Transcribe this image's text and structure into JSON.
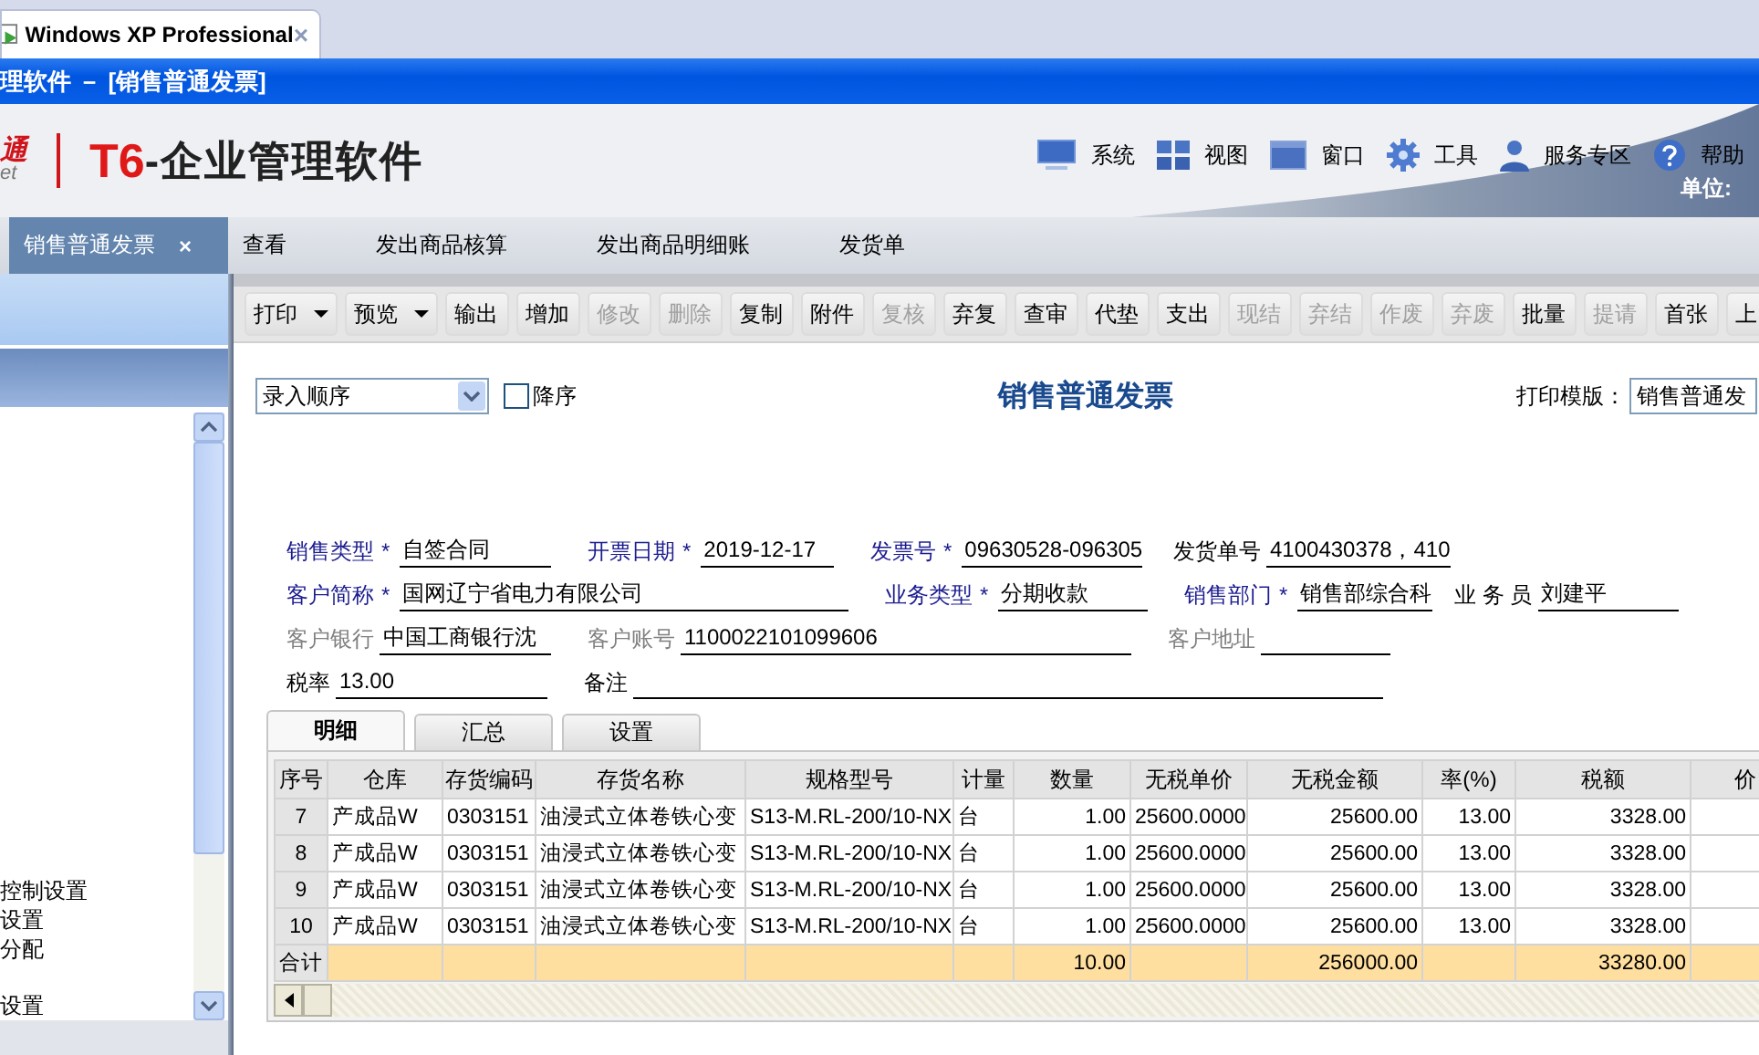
{
  "browser_tab": {
    "title": "Windows XP Professional",
    "close": "×"
  },
  "window": {
    "title": "理软件 － [销售普通发票]"
  },
  "header": {
    "logo_mark": "通",
    "logo_sub": "et",
    "brand_code": "T6",
    "brand_name": "-企业管理软件",
    "menu": [
      {
        "label": "系统",
        "kind": "monitor"
      },
      {
        "label": "视图",
        "kind": "grid"
      },
      {
        "label": "窗口",
        "kind": "window"
      },
      {
        "label": "工具",
        "kind": "gear"
      },
      {
        "label": "服务专区",
        "kind": "person"
      },
      {
        "label": "帮助",
        "kind": "help"
      }
    ],
    "unit": "单位:"
  },
  "doc_tabs": [
    {
      "label": "销售普通发票",
      "selected": true,
      "close": "×"
    },
    {
      "label": "查看",
      "selected": false
    },
    {
      "label": "发出商品核算",
      "selected": false
    },
    {
      "label": "发出商品明细账",
      "selected": false
    },
    {
      "label": "发货单",
      "selected": false
    }
  ],
  "sidebar": {
    "items": [
      "控制设置",
      "设置",
      "分配",
      "设置"
    ]
  },
  "toolbar": [
    {
      "label": "打印",
      "dropdown": true,
      "disabled": false
    },
    {
      "label": "预览",
      "dropdown": true,
      "disabled": false
    },
    {
      "label": "输出",
      "dropdown": false,
      "disabled": false
    },
    {
      "label": "增加",
      "dropdown": false,
      "disabled": false
    },
    {
      "label": "修改",
      "dropdown": false,
      "disabled": true
    },
    {
      "label": "删除",
      "dropdown": false,
      "disabled": true
    },
    {
      "label": "复制",
      "dropdown": false,
      "disabled": false
    },
    {
      "label": "附件",
      "dropdown": false,
      "disabled": false
    },
    {
      "label": "复核",
      "dropdown": false,
      "disabled": true
    },
    {
      "label": "弃复",
      "dropdown": false,
      "disabled": false
    },
    {
      "label": "查审",
      "dropdown": false,
      "disabled": false
    },
    {
      "label": "代垫",
      "dropdown": false,
      "disabled": false
    },
    {
      "label": "支出",
      "dropdown": false,
      "disabled": false
    },
    {
      "label": "现结",
      "dropdown": false,
      "disabled": true
    },
    {
      "label": "弃结",
      "dropdown": false,
      "disabled": true
    },
    {
      "label": "作废",
      "dropdown": false,
      "disabled": true
    },
    {
      "label": "弃废",
      "dropdown": false,
      "disabled": true
    },
    {
      "label": "批量",
      "dropdown": false,
      "disabled": false
    },
    {
      "label": "提请",
      "dropdown": false,
      "disabled": true
    },
    {
      "label": "首张",
      "dropdown": false,
      "disabled": false
    },
    {
      "label": "上",
      "dropdown": false,
      "disabled": false
    }
  ],
  "sort": {
    "value": "录入顺序",
    "descending_label": "降序",
    "descending": false
  },
  "form_title": "销售普通发票",
  "template": {
    "label": "打印模版：",
    "value": "销售普通发"
  },
  "fields": [
    [
      {
        "label": "销售类型",
        "kind": "required",
        "mark": "*",
        "value": "自签合同"
      },
      {
        "label": "开票日期",
        "kind": "required",
        "mark": "*",
        "value": "2019-12-17"
      },
      {
        "label": "发票号",
        "kind": "required",
        "mark": "*",
        "value": "09630528-096305"
      },
      {
        "label": "发货单号",
        "kind": "plain",
        "value": "4100430378，410"
      }
    ],
    [
      {
        "label": "客户简称",
        "kind": "required",
        "mark": "*",
        "value": "国网辽宁省电力有限公司"
      },
      {
        "label": "业务类型",
        "kind": "required",
        "mark": "*",
        "value": "分期收款"
      },
      {
        "label": "销售部门",
        "kind": "required",
        "mark": "*",
        "value": "销售部综合科"
      },
      {
        "label": "业 务 员",
        "kind": "plain",
        "value": "刘建平"
      }
    ],
    [
      {
        "label": "客户银行",
        "kind": "optional",
        "value": "中国工商银行沈"
      },
      {
        "label": "客户账号",
        "kind": "optional",
        "value": "1100022101099606"
      },
      {
        "label": "客户地址",
        "kind": "optional"
      }
    ],
    [
      {
        "label": "税率",
        "kind": "plain",
        "value": "13.00"
      },
      {
        "label": "备注",
        "kind": "plain"
      }
    ]
  ],
  "detail_tabs": [
    {
      "label": "明细",
      "selected": true
    },
    {
      "label": "汇总",
      "selected": false
    },
    {
      "label": "设置",
      "selected": false
    }
  ],
  "table": {
    "columns": [
      "序号",
      "仓库",
      "存货编码",
      "存货名称",
      "规格型号",
      "计量",
      "数量",
      "无税单价",
      "无税金额",
      "率(%)",
      "税额",
      "价"
    ],
    "rows": [
      [
        "7",
        "产成品W",
        "0303151",
        "油浸式立体卷铁心变",
        "S13-M.RL-200/10-NX",
        "台",
        "1.00",
        "25600.0000",
        "25600.00",
        "13.00",
        "3328.00"
      ],
      [
        "8",
        "产成品W",
        "0303151",
        "油浸式立体卷铁心变",
        "S13-M.RL-200/10-NX",
        "台",
        "1.00",
        "25600.0000",
        "25600.00",
        "13.00",
        "3328.00"
      ],
      [
        "9",
        "产成品W",
        "0303151",
        "油浸式立体卷铁心变",
        "S13-M.RL-200/10-NX",
        "台",
        "1.00",
        "25600.0000",
        "25600.00",
        "13.00",
        "3328.00"
      ],
      [
        "10",
        "产成品W",
        "0303151",
        "油浸式立体卷铁心变",
        "S13-M.RL-200/10-NX",
        "台",
        "1.00",
        "25600.0000",
        "25600.00",
        "13.00",
        "3328.00"
      ]
    ],
    "total": {
      "label": "合计",
      "quantity": "10.00",
      "amount": "256000.00",
      "tax": "33280.00"
    }
  }
}
